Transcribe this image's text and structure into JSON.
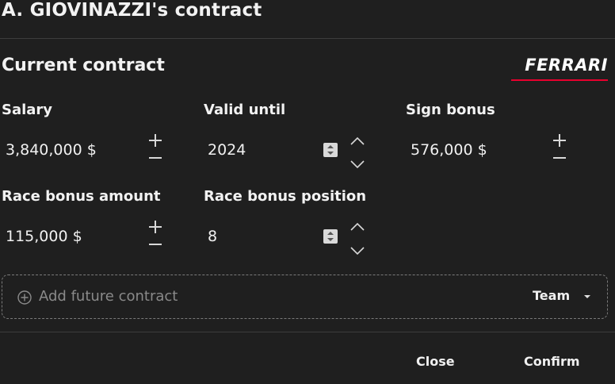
{
  "dialog": {
    "title": "A. GIOVINAZZI's contract"
  },
  "current_contract": {
    "heading": "Current contract",
    "team_logo_text": "FERRARI",
    "team_accent_color": "#e8002d",
    "fields": {
      "salary": {
        "label": "Salary",
        "value": "3,840,000 $"
      },
      "valid_until": {
        "label": "Valid until",
        "value": "2024"
      },
      "sign_bonus": {
        "label": "Sign bonus",
        "value": "576,000 $"
      },
      "race_bonus_amount": {
        "label": "Race bonus amount",
        "value": "115,000 $"
      },
      "race_bonus_position": {
        "label": "Race bonus position",
        "value": "8"
      }
    }
  },
  "future_contract": {
    "add_label": "Add future contract",
    "team_dropdown": "Team"
  },
  "footer": {
    "close_label": "Close",
    "confirm_label": "Confirm"
  },
  "icons": {
    "increment": "plus-icon",
    "decrement": "minus-icon",
    "spin_up": "chevron-up-icon",
    "spin_down": "chevron-down-icon",
    "add": "plus-circle-icon",
    "dropdown": "caret-down-icon"
  }
}
